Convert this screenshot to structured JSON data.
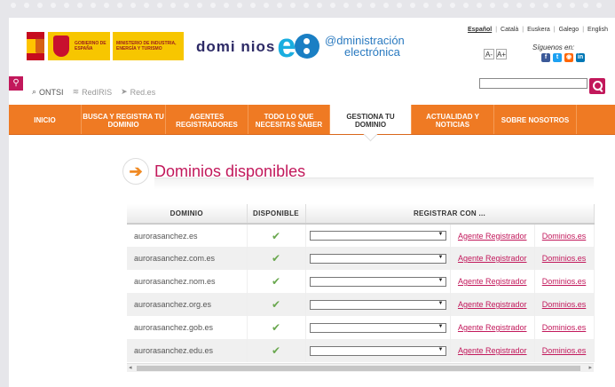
{
  "header": {
    "gov_text": "GOBIERNO DE ESPAÑA",
    "ministry_text": "MINISTERIO DE INDUSTRIA, ENERGÍA Y TURISMO",
    "brand_small": "domi nios",
    "brand_es": "es",
    "admin_line1": "@dministración",
    "admin_line2": "electrónica",
    "languages": [
      "Español",
      "Català",
      "Euskera",
      "Galego",
      "English"
    ],
    "font_smaller": "A-",
    "font_larger": "A+",
    "follow_label": "Síguenos en:",
    "search_placeholder": ""
  },
  "quicklinks": [
    "ONTSI",
    "RedIRIS",
    "Red.es"
  ],
  "nav": [
    {
      "label": "INICIO",
      "w": 82
    },
    {
      "label": "BUSCA Y REGISTRA TU DOMINIO",
      "w": 95
    },
    {
      "label": "AGENTES REGISTRADORES",
      "w": 93
    },
    {
      "label": "TODO LO QUE NECESITAS SABER",
      "w": 92
    },
    {
      "label": "GESTIONA TU DOMINIO",
      "w": 92
    },
    {
      "label": "ACTUALIDAD Y NOTICIAS",
      "w": 93
    },
    {
      "label": "SOBRE NOSOTROS",
      "w": 93
    }
  ],
  "nav_active": "GESTIONA TU DOMINIO",
  "main": {
    "title": "Dominios disponibles",
    "columns": {
      "domain": "DOMINIO",
      "available": "DISPONIBLE",
      "register": "REGISTRAR CON ..."
    },
    "rows": [
      {
        "domain": "aurorasanchez.es",
        "available": true,
        "agent": "Agente Registrador",
        "dominios": "Dominios.es"
      },
      {
        "domain": "aurorasanchez.com.es",
        "available": true,
        "agent": "Agente Registrador",
        "dominios": "Dominios.es"
      },
      {
        "domain": "aurorasanchez.nom.es",
        "available": true,
        "agent": "Agente Registrador",
        "dominios": "Dominios.es"
      },
      {
        "domain": "aurorasanchez.org.es",
        "available": true,
        "agent": "Agente Registrador",
        "dominios": "Dominios.es"
      },
      {
        "domain": "aurorasanchez.gob.es",
        "available": true,
        "agent": "Agente Registrador",
        "dominios": "Dominios.es"
      },
      {
        "domain": "aurorasanchez.edu.es",
        "available": true,
        "agent": "Agente Registrador",
        "dominios": "Dominios.es"
      }
    ],
    "check_glyph": "✔"
  },
  "colors": {
    "accent_orange": "#ef7a23",
    "accent_pink": "#c2185b",
    "brand_blue": "#1aaee0"
  }
}
